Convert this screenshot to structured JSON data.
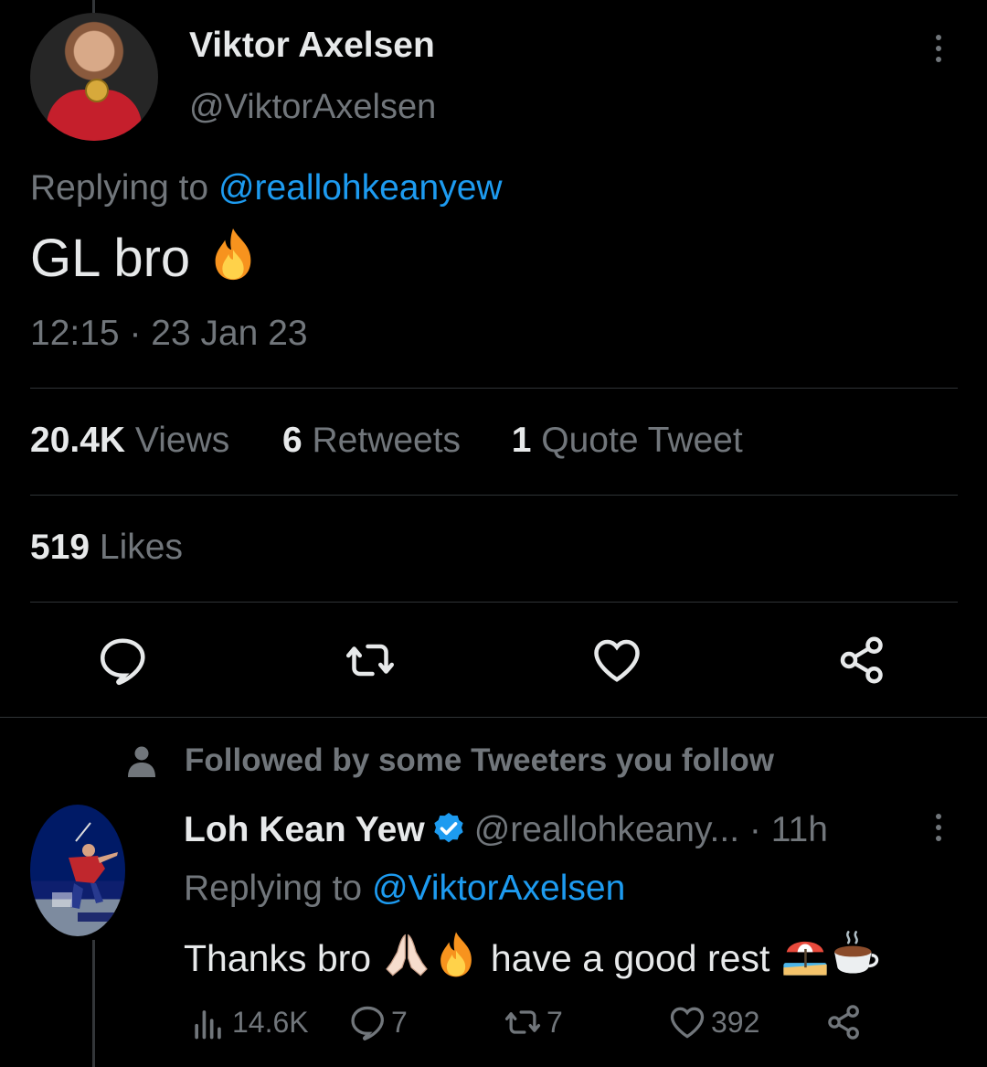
{
  "main_tweet": {
    "name": "Viktor Axelsen",
    "handle": "@ViktorAxelsen",
    "replying_prefix": "Replying to ",
    "replying_to": "@reallohkeanyew",
    "text": "GL bro",
    "time": "12:15",
    "separator": " · ",
    "date": "23 Jan 23",
    "stats": {
      "views_count": "20.4K",
      "views_label": " Views",
      "retweets_count": "6",
      "retweets_label": " Retweets",
      "quotes_count": "1",
      "quotes_label": " Quote Tweet",
      "likes_count": "519",
      "likes_label": " Likes"
    },
    "icons": [
      "reply-icon",
      "retweet-icon",
      "like-icon",
      "share-icon"
    ]
  },
  "reply_section": {
    "followed_text": "Followed by some Tweeters you follow",
    "reply": {
      "name": "Loh Kean Yew",
      "handle": "@reallohkeany...",
      "separator": " · ",
      "time": "11h",
      "replying_prefix": "Replying to ",
      "replying_to": "@ViktorAxelsen",
      "text_part1": "Thanks bro ",
      "text_part2": " have a good rest ",
      "views": "14.6K",
      "replies": "7",
      "retweets": "7",
      "likes": "392"
    }
  },
  "colors": {
    "background": "#000000",
    "primary_text": "#e7e9ea",
    "secondary_text": "#71767b",
    "accent": "#1d9bf0",
    "divider": "#2f3336"
  }
}
